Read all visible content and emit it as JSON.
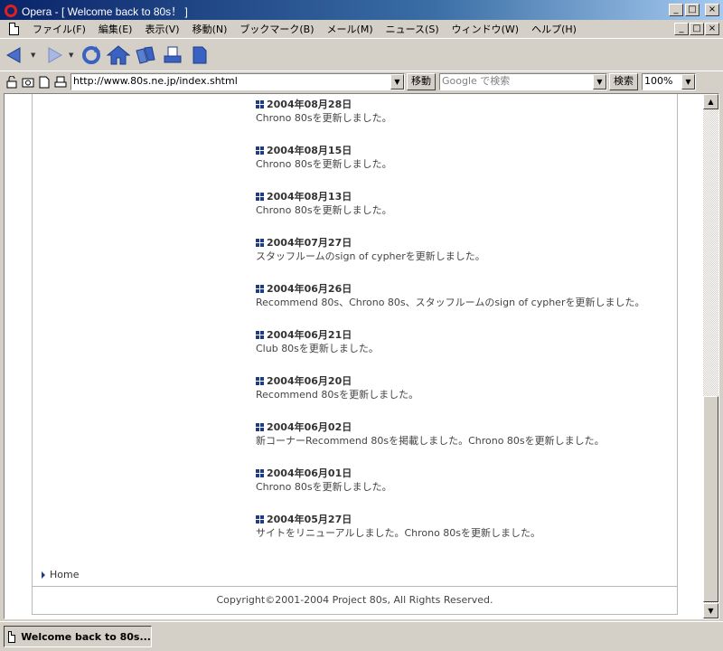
{
  "window": {
    "title": "Opera - [ Welcome back to 80s！ ]",
    "min_glyph": "_",
    "max_glyph": "□",
    "close_glyph": "×"
  },
  "menu": {
    "items": [
      {
        "label": "ファイル(F)"
      },
      {
        "label": "編集(E)"
      },
      {
        "label": "表示(V)"
      },
      {
        "label": "移動(N)"
      },
      {
        "label": "ブックマーク(B)"
      },
      {
        "label": "メール(M)"
      },
      {
        "label": "ニュース(S)"
      },
      {
        "label": "ウィンドウ(W)"
      },
      {
        "label": "ヘルプ(H)"
      }
    ]
  },
  "toolbar": {
    "icons": [
      "back-icon",
      "forward-icon",
      "reload-icon",
      "home-icon",
      "hotlist-icon",
      "print-icon",
      "document-icon"
    ]
  },
  "address": {
    "url": "http://www.80s.ne.jp/index.shtml",
    "go_label": "移動",
    "search_placeholder": "Google で検索",
    "search_label": "検索",
    "zoom": "100%"
  },
  "news": [
    {
      "date": "2004年08月28日",
      "text": "Chrono 80sを更新しました。"
    },
    {
      "date": "2004年08月15日",
      "text": "Chrono 80sを更新しました。"
    },
    {
      "date": "2004年08月13日",
      "text": "Chrono 80sを更新しました。"
    },
    {
      "date": "2004年07月27日",
      "text": "スタッフルームのsign of cypherを更新しました。"
    },
    {
      "date": "2004年06月26日",
      "text": "Recommend 80s、Chrono 80s、スタッフルームのsign of cypherを更新しました。"
    },
    {
      "date": "2004年06月21日",
      "text": "Club 80sを更新しました。"
    },
    {
      "date": "2004年06月20日",
      "text": "Recommend 80sを更新しました。"
    },
    {
      "date": "2004年06月02日",
      "text": "新コーナーRecommend 80sを掲載しました。Chrono 80sを更新しました。"
    },
    {
      "date": "2004年06月01日",
      "text": "Chrono 80sを更新しました。"
    },
    {
      "date": "2004年05月27日",
      "text": "サイトをリニューアルしました。Chrono 80sを更新しました。"
    }
  ],
  "home_link": "Home",
  "footer": "Copyright©2001-2004 Project 80s, All Rights Reserved.",
  "tab": {
    "label": "Welcome back to 80s..."
  }
}
